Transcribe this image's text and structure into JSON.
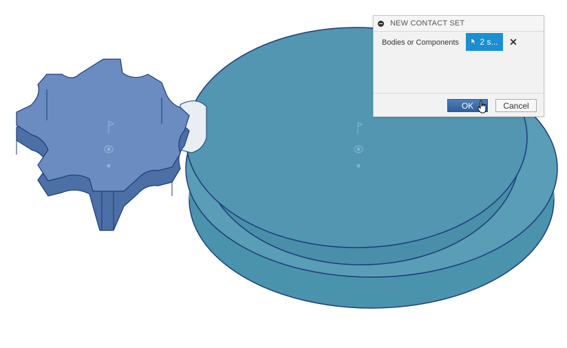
{
  "dialog": {
    "title": "NEW CONTACT SET",
    "field_label": "Bodies or Components",
    "selection_value": "2 s...",
    "ok_label": "OK",
    "cancel_label": "Cancel"
  },
  "icons": {
    "collapse": "collapse-circle-icon",
    "cursor": "cursor-arrow-icon",
    "clear": "close-x-icon",
    "pointer": "hand-pointer-icon"
  },
  "colors": {
    "body_blue": "#4f93b0",
    "gear_blue": "#5a7fb4",
    "edge": "#1e3a7a",
    "selection_blue": "#1a8fd3",
    "ok_blue": "#3a6aa8"
  }
}
